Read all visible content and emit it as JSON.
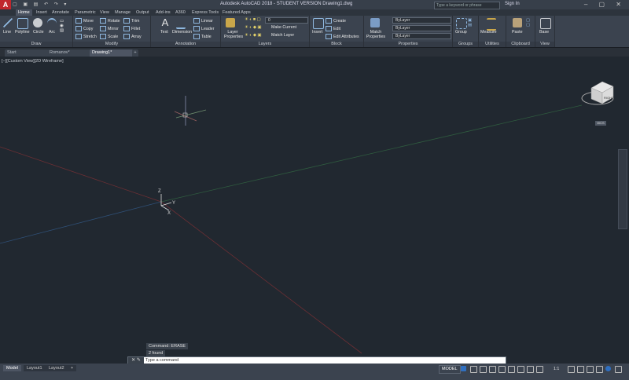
{
  "app": {
    "logo": "A",
    "title": "Autodesk AutoCAD 2018 - STUDENT VERSION      Drawing1.dwg",
    "search_placeholder": "Type a keyword or phrase",
    "signin": "Sign In"
  },
  "ribbon_tabs": [
    "Home",
    "Insert",
    "Annotate",
    "Parametric",
    "View",
    "Manage",
    "Output",
    "Add-ins",
    "A360",
    "Express Tools",
    "Featured Apps"
  ],
  "panels": {
    "draw": {
      "title": "Draw",
      "line": "Line",
      "polyline": "Polyline",
      "circle": "Circle",
      "arc": "Arc"
    },
    "modify": {
      "title": "Modify",
      "move": "Move",
      "rotate": "Rotate",
      "trim": "Trim",
      "copy": "Copy",
      "mirror": "Mirror",
      "fillet": "Fillet",
      "stretch": "Stretch",
      "scale": "Scale",
      "array": "Array"
    },
    "annotation": {
      "title": "Annotation",
      "text": "Text",
      "dimension": "Dimension",
      "linear": "Linear",
      "leader": "Leader",
      "table": "Table"
    },
    "layers": {
      "title": "Layers",
      "layer_properties": "Layer Properties",
      "layer_value": "0",
      "make_current": "Make Current",
      "match_layer": "Match Layer"
    },
    "block": {
      "title": "Block",
      "insert": "Insert",
      "create": "Create",
      "edit": "Edit",
      "edit_attributes": "Edit Attributes"
    },
    "properties": {
      "title": "Properties",
      "match_properties": "Match Properties",
      "bylayer_color": "ByLayer",
      "bylayer_linetype": "ByLayer",
      "bylayer_lineweight": "ByLayer"
    },
    "groups": {
      "title": "Groups",
      "group": "Group"
    },
    "utilities": {
      "title": "Utilities",
      "measure": "Measure"
    },
    "clipboard": {
      "title": "Clipboard",
      "paste": "Paste"
    },
    "view": {
      "title": "View",
      "base": "Base"
    }
  },
  "doc_tabs": [
    "Start",
    "Romanov*",
    "Drawing1*"
  ],
  "viewport_label": "[−][Custom View][2D Wireframe]",
  "viewcube": {
    "face": "RIGHT",
    "wcs": "WCS"
  },
  "command": {
    "history": [
      "Command:  ERASE",
      "2  found"
    ],
    "prompt": "Type a command"
  },
  "layout_tabs": [
    "Model",
    "Layout1",
    "Layout2"
  ],
  "status": {
    "model": "MODEL",
    "scale": "1:1"
  },
  "colors": {
    "background": "#212830",
    "ribbon": "#3b434f",
    "accent": "#c1272d"
  }
}
